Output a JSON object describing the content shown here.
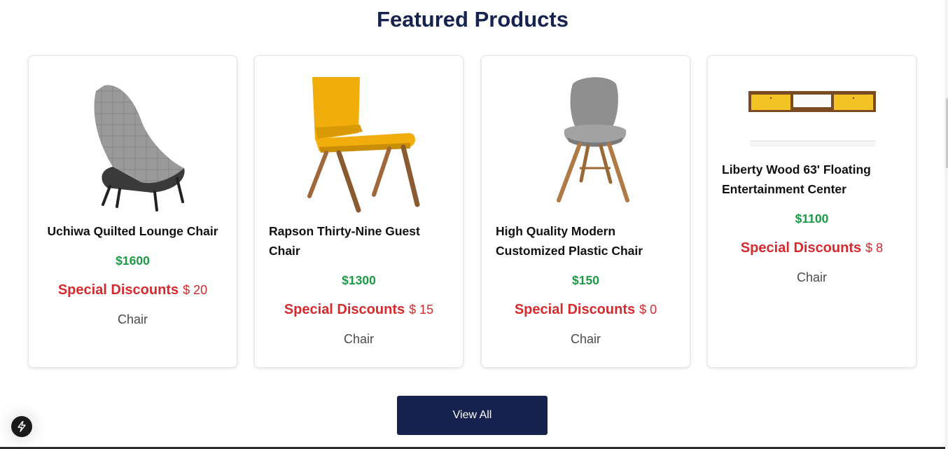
{
  "section": {
    "title": "Featured Products"
  },
  "products": [
    {
      "name": "Uchiwa Quilted Lounge Chair",
      "price": "$1600",
      "discount_label": "Special Discounts",
      "discount_amount": "$ 20",
      "category": "Chair",
      "image_icon": "lounge-chair-image"
    },
    {
      "name": "Rapson Thirty-Nine Guest Chair",
      "price": "$1300",
      "discount_label": "Special Discounts",
      "discount_amount": "$ 15",
      "category": "Chair",
      "image_icon": "yellow-guest-chair-image"
    },
    {
      "name": "High Quality Modern Customized Plastic Chair",
      "price": "$150",
      "discount_label": "Special Discounts",
      "discount_amount": "$ 0",
      "category": "Chair",
      "image_icon": "plastic-chair-image"
    },
    {
      "name": "Liberty Wood 63' Floating Entertainment Center",
      "price": "$1100",
      "discount_label": "Special Discounts",
      "discount_amount": "$ 8",
      "category": "Chair",
      "image_icon": "entertainment-center-image"
    }
  ],
  "actions": {
    "view_all_label": "View All"
  },
  "colors": {
    "primary": "#16234f",
    "price": "#1b9a45",
    "discount": "#d52a2e"
  }
}
